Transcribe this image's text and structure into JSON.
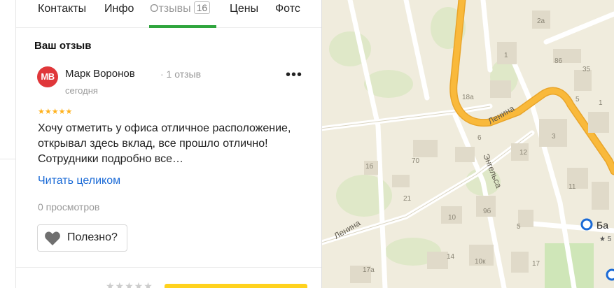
{
  "tabs": [
    {
      "label": "Контакты"
    },
    {
      "label": "Инфо"
    },
    {
      "label": "Отзывы",
      "count": "16",
      "active": true
    },
    {
      "label": "Цены"
    },
    {
      "label": "Фотс"
    }
  ],
  "review": {
    "section_title": "Ваш отзыв",
    "avatar_initials": "MB",
    "author": "Марк Воронов",
    "author_reviews": "· 1 отзыв",
    "date": "сегодня",
    "rating": 5,
    "stars": "★★★★★",
    "more_icon": "more-dots-icon",
    "more_label": "•••",
    "text": "Хочу отметить у офиса отличное расположение, открывал здесь вклад, все прошло отлично! Сотрудники подробно все…",
    "read_more": "Читать целиком",
    "views": "0 просмотров",
    "useful_label": "Полезно?",
    "useful_icon": "heart-icon"
  },
  "bottom": {
    "stars": "★★★★★"
  },
  "map": {
    "streets": {
      "lenina_main": "Ленина",
      "lenina_lower": "Ленина",
      "engelsa": "Энгельса"
    },
    "house_numbers": [
      "2а",
      "1",
      "86",
      "35",
      "18а",
      "5",
      "3",
      "70",
      "1б",
      "12",
      "21",
      "9б",
      "11",
      "10",
      "5",
      "14",
      "10к",
      "17а",
      "17",
      "1",
      "6"
    ],
    "poi_label": "Ба",
    "poi_rating": "★ 5"
  },
  "colors": {
    "accent_green": "#2fa53d",
    "link_blue": "#1a6ad6",
    "star_yellow": "#ffb21e",
    "avatar_red": "#e0373a",
    "main_road": "#f9b93b",
    "button_yellow": "#ffd21e"
  }
}
